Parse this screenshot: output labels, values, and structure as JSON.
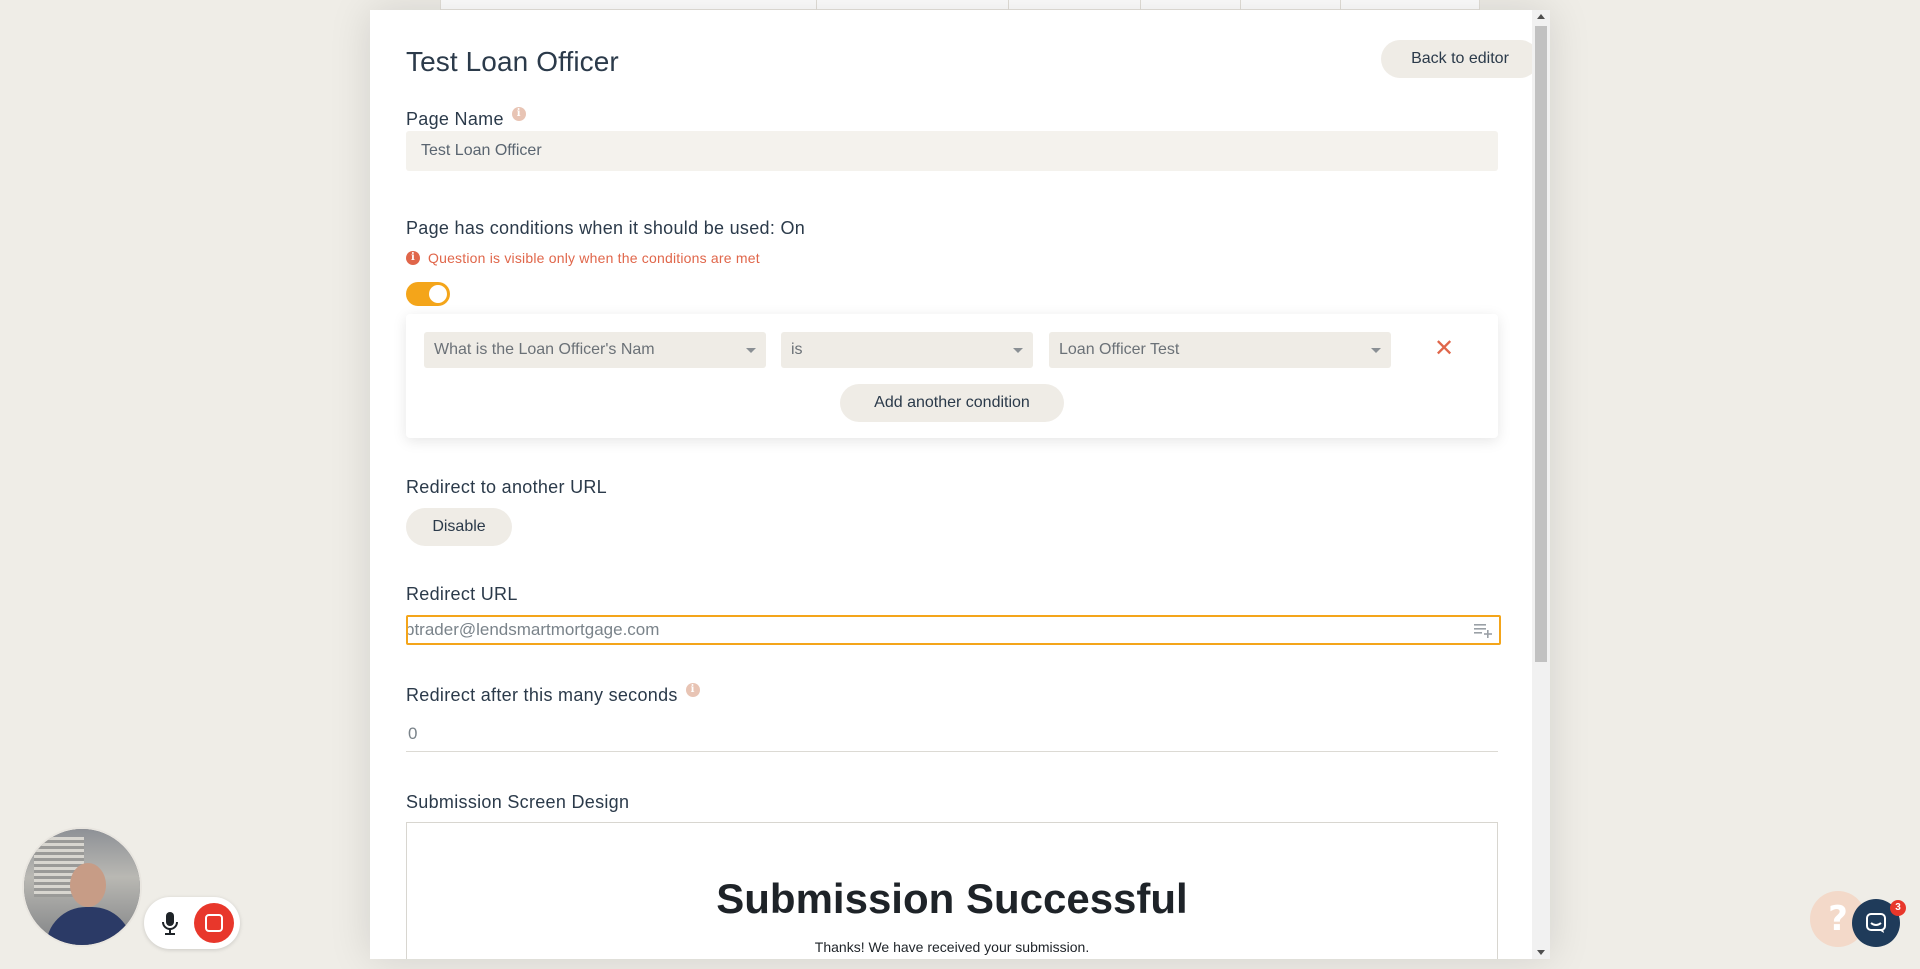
{
  "modal": {
    "title": "Test Loan Officer",
    "back_button": "Back to editor"
  },
  "page_name": {
    "label": "Page Name",
    "value": "Test Loan Officer"
  },
  "conditions": {
    "label": "Page has conditions when it should be used: On",
    "warning": "Question is visible only when the conditions are met",
    "toggle_on": true,
    "rows": [
      {
        "field": "What is the Loan Officer's Nam",
        "operator": "is",
        "value": "Loan Officer Test"
      }
    ],
    "add_button": "Add another condition"
  },
  "redirect": {
    "label": "Redirect to another URL",
    "disable_button": "Disable",
    "url_label": "Redirect URL",
    "url_value": "btrader@lendsmartmortgage.com",
    "seconds_label": "Redirect after this many seconds",
    "seconds_value": "0"
  },
  "submission": {
    "label": "Submission Screen Design",
    "preview_title": "Submission Successful",
    "preview_subtitle": "Thanks! We have received your submission."
  },
  "chat": {
    "help_glyph": "?",
    "badge_count": "3"
  },
  "colors": {
    "accent": "#f4a51a",
    "danger": "#e0664a",
    "record": "#e8372b",
    "chat": "#1f3b5a"
  },
  "icons": [
    "info-icon",
    "warning-icon",
    "close-icon",
    "chevron-down-icon",
    "insert-variable-icon",
    "microphone-icon",
    "stop-icon",
    "help-icon",
    "chat-icon"
  ]
}
